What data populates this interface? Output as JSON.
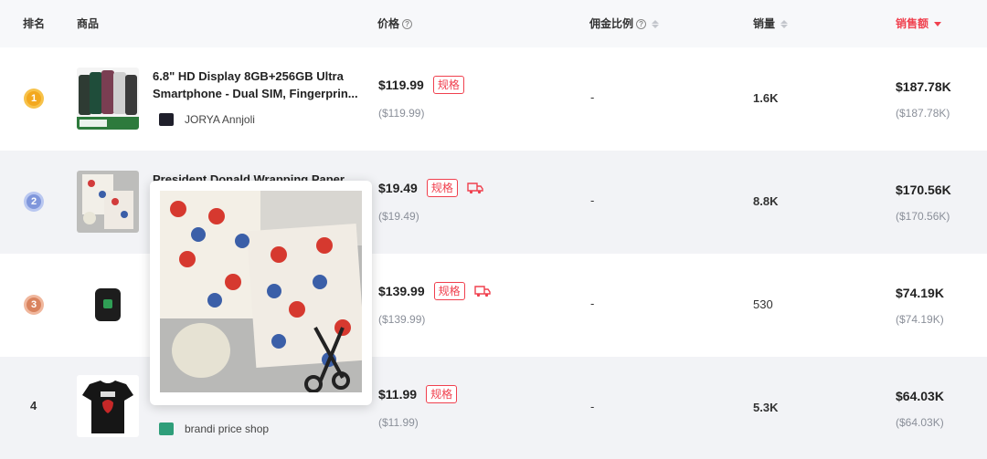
{
  "header": {
    "rank": "排名",
    "product": "商品",
    "price": "价格",
    "commission": "佣金比例",
    "sales": "销量",
    "revenue": "销售额"
  },
  "rows": [
    {
      "rank": "1",
      "title": "6.8\" HD Display 8GB+256GB Ultra Smartphone - Dual SIM, Fingerprin...",
      "shop": "JORYA Annjoli",
      "price": "$119.99",
      "price_sub": "($119.99)",
      "spec": "规格",
      "commission": "-",
      "sales": "1.6K",
      "revenue": "$187.78K",
      "revenue_sub": "($187.78K)"
    },
    {
      "rank": "2",
      "title": "President Donald Wrapping Paper",
      "shop": "",
      "price": "$19.49",
      "price_sub": "($19.49)",
      "spec": "规格",
      "commission": "-",
      "sales": "8.8K",
      "revenue": "$170.56K",
      "revenue_sub": "($170.56K)"
    },
    {
      "rank": "3",
      "title": "",
      "shop": "",
      "price": "$139.99",
      "price_sub": "($139.99)",
      "spec": "规格",
      "commission": "-",
      "sales": "530",
      "revenue": "$74.19K",
      "revenue_sub": "($74.19K)"
    },
    {
      "rank": "4",
      "title": "",
      "shop": "brandi price shop",
      "price": "$11.99",
      "price_sub": "($11.99)",
      "spec": "规格",
      "commission": "-",
      "sales": "5.3K",
      "revenue": "$64.03K",
      "revenue_sub": "($64.03K)"
    }
  ],
  "colors": {
    "accent": "#f0404e",
    "header_bg": "#f7f8fa",
    "alt_row_bg": "#f2f3f6"
  }
}
